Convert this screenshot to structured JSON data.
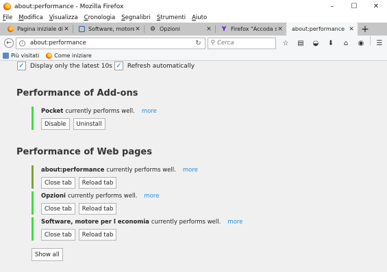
{
  "window": {
    "title": "about:performance - Mozilla Firefox",
    "minimize": "–",
    "maximize": "☐",
    "close": "✕"
  },
  "menubar": [
    {
      "first": "F",
      "rest": "ile"
    },
    {
      "first": "M",
      "rest": "odifica"
    },
    {
      "first": "V",
      "rest": "isualizza"
    },
    {
      "first": "C",
      "rest": "ronologia"
    },
    {
      "first": "S",
      "rest": "egnalibri"
    },
    {
      "first": "S",
      "rest": "trumenti"
    },
    {
      "first": "A",
      "rest": "iuto"
    }
  ],
  "tabs": [
    {
      "label": "Pagina iniziale di M...",
      "icon": "firefox-icon"
    },
    {
      "label": "Software, motore p...",
      "icon": "software-icon"
    },
    {
      "label": "Opzioni",
      "icon": "gear-icon"
    },
    {
      "label": "Firefox \"Accoda sc...",
      "icon": "yahoo-icon"
    },
    {
      "label": "about:performance",
      "icon": "",
      "active": true
    }
  ],
  "navbar": {
    "url": "about:performance",
    "search_placeholder": "Cerca"
  },
  "bookmarks": [
    {
      "label": "Più visitati",
      "icon": "folder-icon"
    },
    {
      "label": "Come iniziare",
      "icon": "firefox-icon"
    }
  ],
  "options": {
    "latest_label": "Display only the latest 10s",
    "refresh_label": "Refresh automatically",
    "latest_checked": true,
    "refresh_checked": true
  },
  "addons": {
    "title": "Performance of Add-ons",
    "entries": [
      {
        "name": "Pocket",
        "status": "currently performs well.",
        "more": "more",
        "buttons": [
          "Disable",
          "Uninstall"
        ]
      }
    ]
  },
  "webpages": {
    "title": "Performance of Web pages",
    "entries": [
      {
        "name": "about:performance",
        "status": "currently performs well.",
        "more": "more",
        "buttons": [
          "Close tab",
          "Reload tab"
        ]
      },
      {
        "name": "Opzioni",
        "status": "currently performs well.",
        "more": "more",
        "buttons": [
          "Close tab",
          "Reload tab"
        ]
      },
      {
        "name": "Software, motore per l economia",
        "status": "currently performs well.",
        "more": "more",
        "buttons": [
          "Close tab",
          "Reload tab"
        ]
      }
    ],
    "show_all": "Show all"
  },
  "colors": {
    "accent_green": "#3ddc3d",
    "accent_olive": "#7ca03b",
    "link_blue": "#1f8ce0",
    "check_blue": "#0a84d6"
  }
}
